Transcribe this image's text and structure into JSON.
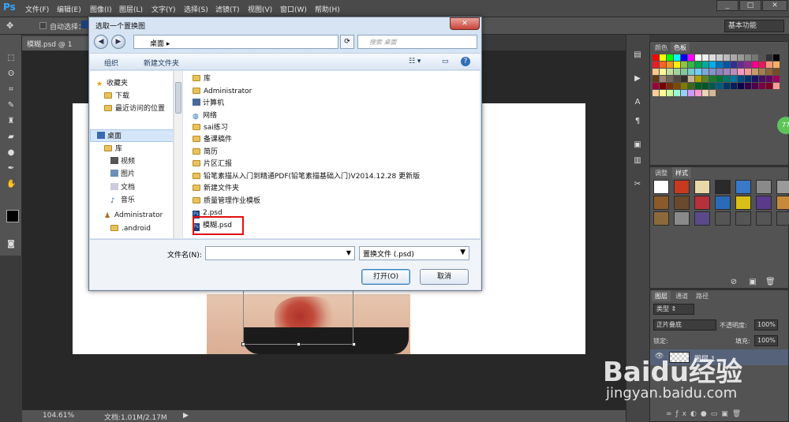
{
  "app": {
    "logo": "Ps"
  },
  "menubar": {
    "items": [
      "文件(F)",
      "编辑(E)",
      "图像(I)",
      "图层(L)",
      "文字(Y)",
      "选择(S)",
      "滤镜(T)",
      "视图(V)",
      "窗口(W)",
      "帮助(H)"
    ]
  },
  "optionsbar": {
    "auto_select": "自动选择：",
    "workspace": "基本功能"
  },
  "document": {
    "tab": "模糊.psd @ 1",
    "zoom": "104.61%",
    "doc_info": "文档:1.01M/2.17M"
  },
  "panels": {
    "swatches_tabs": [
      "颜色",
      "色板"
    ],
    "styles_tabs": [
      "调整",
      "样式"
    ],
    "layers_tabs": [
      "图层",
      "通道",
      "路径"
    ],
    "layer_kind": "类型",
    "blend_mode": "正片叠底",
    "opacity_label": "不透明度:",
    "opacity_value": "100%",
    "lock_label": "锁定:",
    "fill_label": "填充:",
    "fill_value": "100%",
    "layer_name": "图层 1"
  },
  "swatch_colors": [
    "#ff0000",
    "#ffff00",
    "#00ff00",
    "#00ffff",
    "#0000ff",
    "#ff00ff",
    "#ffffff",
    "#eeeeee",
    "#dddddd",
    "#cccccc",
    "#bbbbbb",
    "#aaaaaa",
    "#999999",
    "#888888",
    "#777777",
    "#555555",
    "#333333",
    "#000000",
    "#ed1c24",
    "#f26522",
    "#f7941d",
    "#fff200",
    "#8dc63f",
    "#39b54a",
    "#00a651",
    "#00a99d",
    "#00aeef",
    "#0072bc",
    "#0054a6",
    "#2e3192",
    "#662d91",
    "#92278f",
    "#ec008c",
    "#ed145b",
    "#f69679",
    "#fbaf5d",
    "#fdc68a",
    "#fff799",
    "#c4df9b",
    "#a3d39c",
    "#82ca9c",
    "#7accc8",
    "#6dcff6",
    "#7da7d9",
    "#8393ca",
    "#8781bd",
    "#a186be",
    "#bd8cbf",
    "#f49ac1",
    "#f5989d",
    "#c69c6d",
    "#a67c52",
    "#8c6239",
    "#754c24",
    "#603913",
    "#998675",
    "#736357",
    "#534741",
    "#362f2d",
    "#c7b299",
    "#aba000",
    "#598527",
    "#1a7b30",
    "#007236",
    "#00746b",
    "#0076a3",
    "#004a80",
    "#003471",
    "#1b1464",
    "#440e62",
    "#630460",
    "#9e005d",
    "#9e0039",
    "#790000",
    "#7b2e00",
    "#7d4900",
    "#827b00",
    "#406618",
    "#005e20",
    "#005826",
    "#005952",
    "#005b7f",
    "#003663",
    "#002157",
    "#0d004c",
    "#32004b",
    "#4b0049",
    "#7b0046",
    "#7a0026",
    "#ff9999",
    "#ffcc99",
    "#ffff99",
    "#ccff99",
    "#99ffcc",
    "#99ccff",
    "#cc99ff",
    "#ff99cc",
    "#e8d5b7",
    "#d4b896"
  ],
  "style_swatches": [
    "#ffffff",
    "#c83a1e",
    "#e8d8a8",
    "#2a2a2a",
    "#3a78c8",
    "#8a8a8a",
    "#9a9a9a",
    "#8a5a2a",
    "#6a4a2a",
    "#b8303a",
    "#2a6ab8",
    "#d8c018",
    "#5a3a8a",
    "#c88a3a",
    "#8a6a3a",
    "#8a8a8a",
    "#5a4a8a",
    "#555555",
    "#555555",
    "#555555",
    "#555555"
  ],
  "dialog": {
    "title": "选取一个置换图",
    "close": "✕",
    "address": "桌面",
    "search_placeholder": "搜索 桌面",
    "organize": "组织",
    "new_folder": "新建文件夹",
    "nav": [
      "收藏夹",
      "下载",
      "最近访问的位置",
      "桌面",
      "库",
      "视频",
      "图片",
      "文档",
      "音乐",
      "Administrator",
      ".android"
    ],
    "files": [
      "库",
      "Administrator",
      "计算机",
      "网络",
      "sai练习",
      "备课稿件",
      "简历",
      "片区汇报",
      "铅笔素描从入门到精通PDF(铅笔素描基础入门)V2014.12.28 更新版",
      "新建文件夹",
      "质量管理作业模板",
      "2.psd",
      "模糊.psd"
    ],
    "filename_label": "文件名(N):",
    "filename_value": "",
    "filetype": "置换文件 (.psd)",
    "open": "打开(O)",
    "cancel": "取消"
  },
  "watermark": {
    "brand": "Baidu经验",
    "url": "jingyan.baidu.com",
    "badge": "77"
  }
}
